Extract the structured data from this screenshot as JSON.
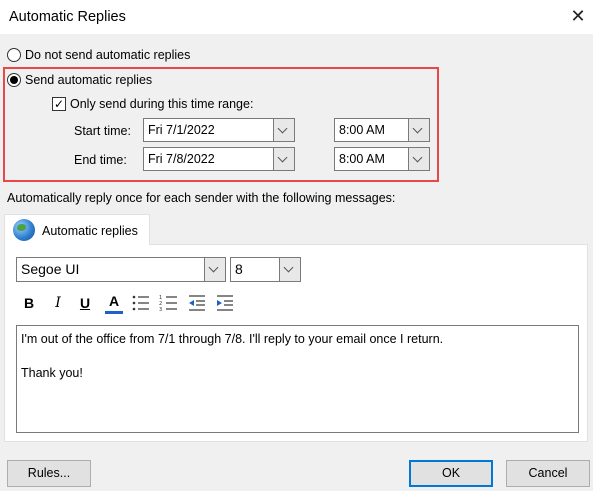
{
  "window": {
    "title": "Automatic Replies"
  },
  "options": {
    "no_send_label": "Do not send automatic replies",
    "send_label": "Send automatic replies",
    "selected": "send",
    "time_range_label": "Only send during this time range:",
    "time_range_checked": true,
    "start_label": "Start time:",
    "start_date": "Fri 7/1/2022",
    "start_time": "8:00 AM",
    "end_label": "End time:",
    "end_date": "Fri 7/8/2022",
    "end_time": "8:00 AM"
  },
  "messages_label": "Automatically reply once for each sender with the following messages:",
  "tab": {
    "label": "Automatic replies"
  },
  "toolbar": {
    "font": "Segoe UI",
    "size": "8",
    "bold": "B",
    "italic": "I",
    "underline": "U",
    "font_color": "A"
  },
  "message": {
    "line1": "I'm out of the office from 7/1 through 7/8. I'll reply to your email once I return.",
    "line2": "Thank you!"
  },
  "buttons": {
    "rules": "Rules...",
    "ok": "OK",
    "cancel": "Cancel"
  },
  "colors": {
    "highlight": "#e8484a",
    "font_color_bar": "#1e62c8",
    "ok_border": "#0078d7"
  }
}
